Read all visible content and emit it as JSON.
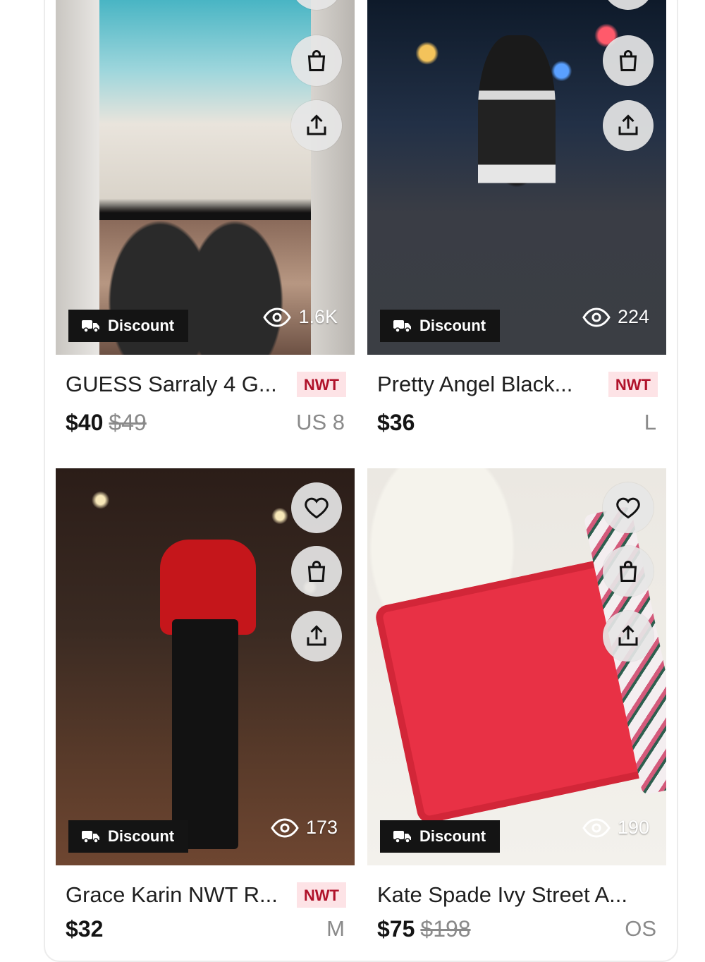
{
  "cards": [
    {
      "badge": "Discount",
      "views": "1.6K",
      "title": "GUESS Sarraly 4 G...",
      "tag": "NWT",
      "price": "$40",
      "original_price": "$49",
      "size": "US 8",
      "image_icon": "sandals-photo"
    },
    {
      "badge": "Discount",
      "views": "224",
      "title": "Pretty Angel Black...",
      "tag": "NWT",
      "price": "$36",
      "original_price": "",
      "size": "L",
      "image_icon": "dress-photo"
    },
    {
      "badge": "Discount",
      "views": "173",
      "title": "Grace Karin NWT R...",
      "tag": "NWT",
      "price": "$32",
      "original_price": "",
      "size": "M",
      "image_icon": "outfit-photo"
    },
    {
      "badge": "Discount",
      "views": "190",
      "title": "Kate Spade Ivy Street A...",
      "tag": "",
      "price": "$75",
      "original_price": "$198",
      "size": "OS",
      "image_icon": "handbag-photo"
    }
  ],
  "icons": {
    "like": "heart-icon",
    "bag": "shopping-bag-icon",
    "share": "share-icon",
    "badge": "truck-icon",
    "views": "eye-icon"
  },
  "colors": {
    "badge_bg": "#141414",
    "nwt_bg": "#fde3e6",
    "nwt_text": "#b0122a"
  }
}
